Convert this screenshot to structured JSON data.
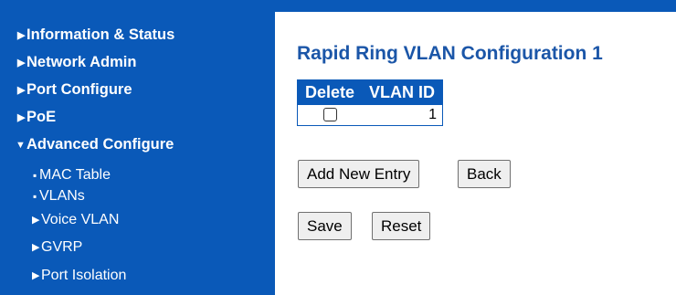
{
  "sidebar": {
    "items": [
      {
        "label": "Information & Status"
      },
      {
        "label": "Network Admin"
      },
      {
        "label": "Port Configure"
      },
      {
        "label": "PoE"
      },
      {
        "label": "Advanced Configure"
      }
    ],
    "subitems": [
      {
        "label": "MAC Table"
      },
      {
        "label": "VLANs"
      },
      {
        "label": "Voice VLAN"
      },
      {
        "label": "GVRP"
      },
      {
        "label": "Port Isolation"
      }
    ]
  },
  "main": {
    "title": "Rapid Ring VLAN Configuration 1",
    "table": {
      "headers": [
        "Delete",
        "VLAN ID"
      ],
      "rows": [
        {
          "delete_checked": false,
          "vlan_id": "1"
        }
      ]
    },
    "buttons": {
      "add_new_entry": "Add New Entry",
      "back": "Back",
      "save": "Save",
      "reset": "Reset"
    }
  },
  "colors": {
    "sidebar_bg": "#0a59b8",
    "title": "#1b56a8"
  }
}
